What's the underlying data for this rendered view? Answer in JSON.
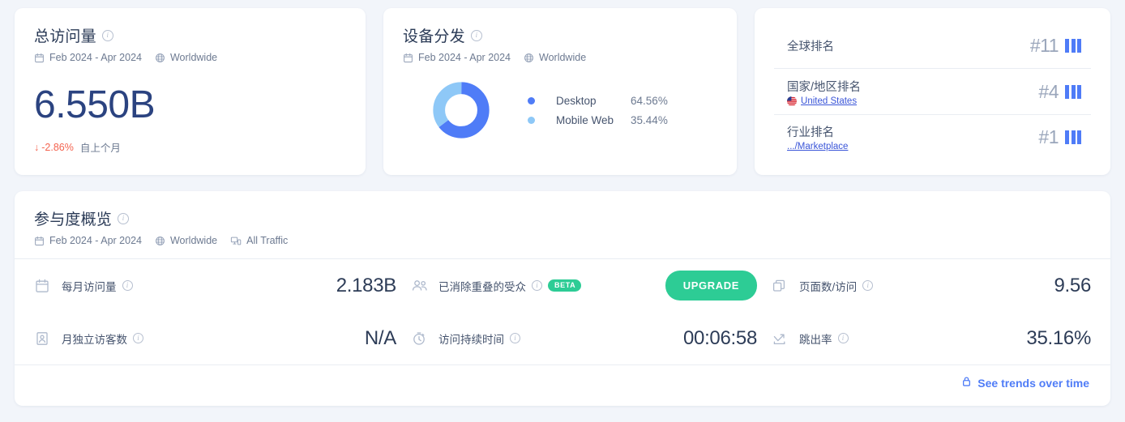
{
  "colors": {
    "page_bg": "#f2f5fa",
    "card_bg": "#ffffff",
    "accent_blue": "#4f7cf7",
    "deep_blue": "#2b4380",
    "green": "#2dcc95",
    "red": "#f4634f",
    "donut_desktop": "#4f7cf7",
    "donut_mobile": "#8ec8f7",
    "link_blue": "#3a55d8"
  },
  "visits_card": {
    "title": "总访问量",
    "info_icon": "info-icon",
    "calendar_icon": "calendar-icon",
    "date_range": "Feb 2024 - Apr 2024",
    "globe_icon": "globe-icon",
    "region": "Worldwide",
    "value": "6.550B",
    "delta_arrow": "↓",
    "delta": "-2.86%",
    "delta_label": "自上个月"
  },
  "devices_card": {
    "title": "设备分发",
    "info_icon": "info-icon",
    "calendar_icon": "calendar-icon",
    "date_range": "Feb 2024 - Apr 2024",
    "globe_icon": "globe-icon",
    "region": "Worldwide",
    "chart_data": {
      "type": "pie",
      "title": "设备分发",
      "categories": [
        "Desktop",
        "Mobile Web"
      ],
      "values": [
        64.56,
        35.44
      ],
      "value_labels": [
        "64.56%",
        "35.44%"
      ],
      "colors": [
        "#4f7cf7",
        "#8ec8f7"
      ],
      "donut": true,
      "legend": "right"
    },
    "legend": [
      {
        "name": "Desktop",
        "pct": "64.56%",
        "color": "#4f7cf7"
      },
      {
        "name": "Mobile Web",
        "pct": "35.44%",
        "color": "#8ec8f7"
      }
    ]
  },
  "ranks_card": {
    "rows": [
      {
        "label": "全球排名",
        "sub": "",
        "has_flag": false,
        "value": "#11",
        "bars_icon": "rank-bars-icon"
      },
      {
        "label": "国家/地区排名",
        "sub": "United States",
        "has_flag": true,
        "flag_icon": "us-flag-icon",
        "value": "#4",
        "bars_icon": "rank-bars-icon"
      },
      {
        "label": "行业排名",
        "sub": ".../Marketplace",
        "has_flag": false,
        "value": "#1",
        "bars_icon": "rank-bars-icon"
      }
    ]
  },
  "engagement_card": {
    "title": "参与度概览",
    "info_icon": "info-icon",
    "calendar_icon": "calendar-icon",
    "date_range": "Feb 2024 - Apr 2024",
    "globe_icon": "globe-icon",
    "region": "Worldwide",
    "devices_icon": "devices-icon",
    "traffic": "All Traffic",
    "metrics": [
      {
        "icon": "calendar-icon",
        "label": "每月访问量",
        "value": "2.183B"
      },
      {
        "icon": "audience-card-icon",
        "label": "已消除重叠的受众",
        "badge": "BETA",
        "button": "UPGRADE"
      },
      {
        "icon": "pages-icon",
        "label": "页面数/访问",
        "value": "9.56"
      },
      {
        "icon": "visitor-icon",
        "label": "月独立访客数",
        "value": "N/A"
      },
      {
        "icon": "clock-icon",
        "label": "访问持续时间",
        "value": "00:06:58"
      },
      {
        "icon": "bounce-icon",
        "label": "跳出率",
        "value": "35.16%"
      }
    ],
    "footer": {
      "lock_icon": "lock-icon",
      "link": "See trends over time"
    }
  }
}
